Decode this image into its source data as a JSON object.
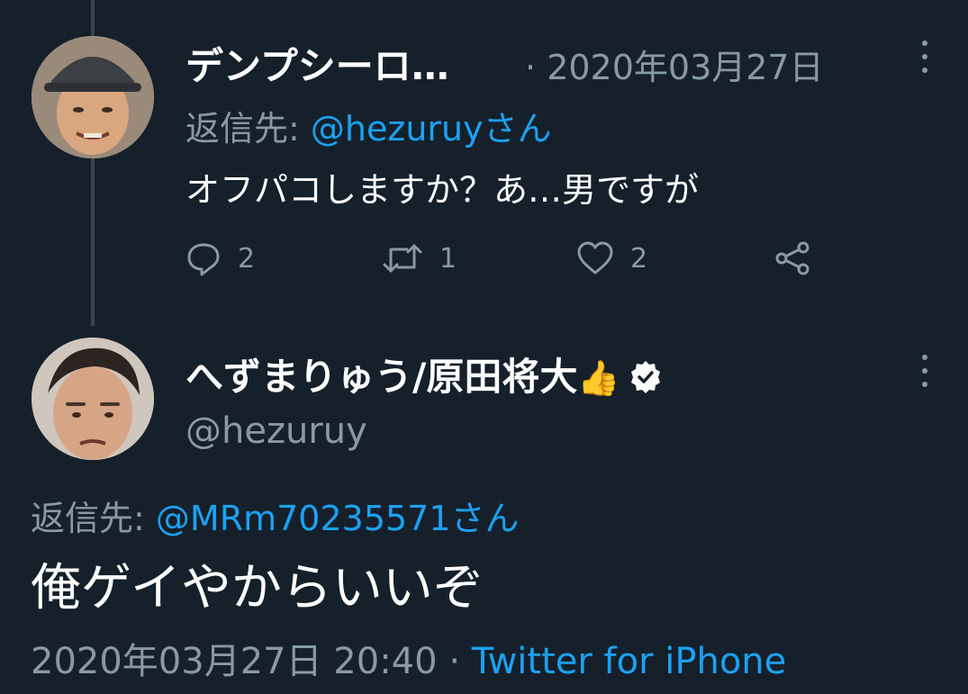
{
  "tweet1": {
    "display_name": "デンプシーロ…",
    "separator": "·",
    "date": "2020年03月27日",
    "reply_label": "返信先:",
    "reply_handle": "@hezuruyさん",
    "text": "オフパコしますか？あ…男ですが",
    "reply_count": "2",
    "retweet_count": "1",
    "like_count": "2",
    "icons": [
      "reply-icon",
      "retweet-icon",
      "like-icon",
      "share-icon",
      "more-icon"
    ]
  },
  "tweet2": {
    "display_name": "へずまりゅう/原田将大",
    "emoji": "👍",
    "handle": "@hezuruy",
    "reply_label": "返信先:",
    "reply_handle": "@MRm70235571さん",
    "text": "俺ゲイやからいいぞ",
    "timestamp": "2020年03月27日 20:40",
    "separator": "·",
    "source": "Twitter for iPhone",
    "icons": [
      "verified-icon",
      "more-icon"
    ]
  },
  "colors": {
    "background": "#15202b",
    "text_primary": "#ffffff",
    "text_secondary": "#8899a6",
    "link": "#1da1f2",
    "thread_line": "#38444d"
  }
}
